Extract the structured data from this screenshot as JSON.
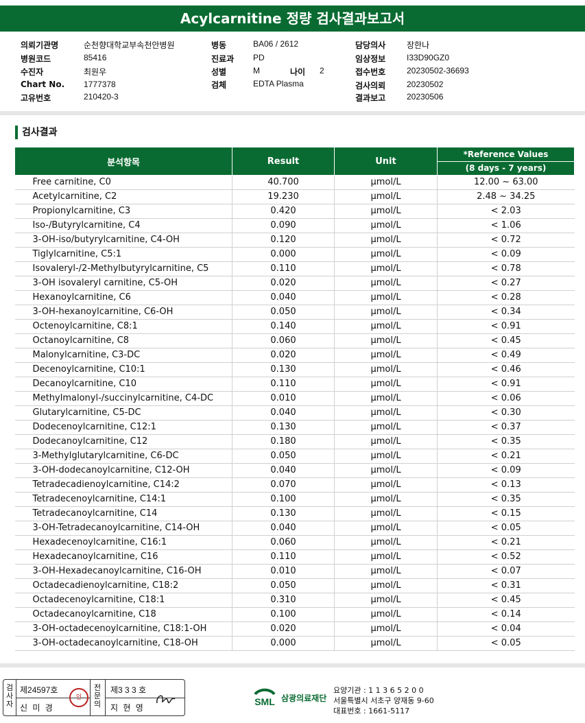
{
  "title": "Acylcarnitine 정량 검사결과보고서",
  "info": {
    "col1": [
      {
        "label": "의뢰기관명",
        "value": "순천향대학교부속천안병원"
      },
      {
        "label": "병원코드",
        "value": "85416"
      },
      {
        "label": "수진자",
        "value": "최원우"
      },
      {
        "label": "Chart No.",
        "value": "1777378"
      },
      {
        "label": "고유번호",
        "value": "210420-3"
      }
    ],
    "col2": [
      {
        "label": "병동",
        "value": "BA06 / 2612"
      },
      {
        "label": "진료과",
        "value": "PD"
      },
      {
        "label": "성별",
        "value": "M"
      },
      {
        "label": "검체",
        "value": "EDTA Plasma"
      }
    ],
    "age": {
      "label": "나이",
      "value": "2"
    },
    "col3": [
      {
        "label": "담당의사",
        "value": "장한나"
      },
      {
        "label": "임상정보",
        "value": "I33D90GZ0"
      },
      {
        "label": "접수번호",
        "value": "20230502-36693"
      },
      {
        "label": "검사의뢰",
        "value": "20230502"
      },
      {
        "label": "결과보고",
        "value": "20230506"
      }
    ]
  },
  "section_title": "검사결과",
  "table": {
    "headers": {
      "item": "분석항목",
      "result": "Result",
      "unit": "Unit",
      "ref": "*Reference Values",
      "ref_sub": "(8 days - 7 years)"
    },
    "rows": [
      [
        "Free carnitine, C0",
        "40.700",
        "μmol/L",
        "12.00 ~ 63.00"
      ],
      [
        "Acetylcarnitine, C2",
        "19.230",
        "μmol/L",
        "2.48 ~ 34.25"
      ],
      [
        "Propionylcarnitine, C3",
        "0.420",
        "μmol/L",
        "< 2.03"
      ],
      [
        "Iso-/Butyrylcarnitine, C4",
        "0.090",
        "μmol/L",
        "< 1.06"
      ],
      [
        "3-OH-iso/butyrylcarnitine, C4-OH",
        "0.120",
        "μmol/L",
        "< 0.72"
      ],
      [
        "Tiglylcarnitine, C5:1",
        "0.000",
        "μmol/L",
        "< 0.09"
      ],
      [
        "Isovaleryl-/2-Methylbutyrylcarnitine, C5",
        "0.110",
        "μmol/L",
        "< 0.78"
      ],
      [
        "3-OH isovaleryl carnitine, C5-OH",
        "0.020",
        "μmol/L",
        "< 0.27"
      ],
      [
        "Hexanoylcarnitine, C6",
        "0.040",
        "μmol/L",
        "< 0.28"
      ],
      [
        "3-OH-hexanoylcarnitine, C6-OH",
        "0.050",
        "μmol/L",
        "< 0.34"
      ],
      [
        "Octenoylcarnitine, C8:1",
        "0.140",
        "μmol/L",
        "< 0.91"
      ],
      [
        "Octanoylcarnitine, C8",
        "0.060",
        "μmol/L",
        "< 0.45"
      ],
      [
        "Malonylcarnitine, C3-DC",
        "0.020",
        "μmol/L",
        "< 0.49"
      ],
      [
        "Decenoylcarnitine, C10:1",
        "0.130",
        "μmol/L",
        "< 0.46"
      ],
      [
        "Decanoylcarnitine, C10",
        "0.110",
        "μmol/L",
        "< 0.91"
      ],
      [
        "Methylmalonyl-/succinylcarnitine, C4-DC",
        "0.010",
        "μmol/L",
        "< 0.06"
      ],
      [
        "Glutarylcarnitine, C5-DC",
        "0.040",
        "μmol/L",
        "< 0.30"
      ],
      [
        "Dodecenoylcarnitine, C12:1",
        "0.130",
        "μmol/L",
        "< 0.37"
      ],
      [
        "Dodecanoylcarnitine, C12",
        "0.180",
        "μmol/L",
        "< 0.35"
      ],
      [
        "3-Methylglutarylcarnitine, C6-DC",
        "0.050",
        "μmol/L",
        "< 0.21"
      ],
      [
        "3-OH-dodecanoylcarnitine, C12-OH",
        "0.040",
        "μmol/L",
        "< 0.09"
      ],
      [
        "Tetradecadienoylcarnitine, C14:2",
        "0.070",
        "μmol/L",
        "< 0.13"
      ],
      [
        "Tetradecenoylcarnitine, C14:1",
        "0.100",
        "μmol/L",
        "< 0.35"
      ],
      [
        "Tetradecanoylcarnitine, C14",
        "0.130",
        "μmol/L",
        "< 0.15"
      ],
      [
        "3-OH-Tetradecanoylcarnitine, C14-OH",
        "0.040",
        "μmol/L",
        "< 0.05"
      ],
      [
        "Hexadecenoylcarnitine, C16:1",
        "0.060",
        "μmol/L",
        "< 0.21"
      ],
      [
        "Hexadecanoylcarnitine, C16",
        "0.110",
        "μmol/L",
        "< 0.52"
      ],
      [
        "3-OH-Hexadecanoylcarnitine, C16-OH",
        "0.010",
        "μmol/L",
        "< 0.07"
      ],
      [
        "Octadecadienoylcarnitine, C18:2",
        "0.050",
        "μmol/L",
        "< 0.31"
      ],
      [
        "Octadecenoylcarnitine, C18:1",
        "0.310",
        "μmol/L",
        "< 0.45"
      ],
      [
        "Octadecanoylcarnitine, C18",
        "0.100",
        "μmol/L",
        "< 0.14"
      ],
      [
        "3-OH-octadecenoylcarnitine, C18:1-OH",
        "0.020",
        "μmol/L",
        "< 0.04"
      ],
      [
        "3-OH-octadecanoylcarnitine, C18-OH",
        "0.000",
        "μmol/L",
        "< 0.05"
      ]
    ]
  },
  "footer": {
    "tester_label": "검사자",
    "tester_license": "제24597호",
    "tester_name": "신 미 경",
    "tester_stamp": "인",
    "specialist_label": "전문의",
    "specialist_license": "제3 3 3 호",
    "specialist_name": "지 현 영",
    "logo_text": "SML",
    "org_name": "삼광의료재단",
    "agency_no": "요양기관 : 1 1 3 6 5 2 0 0",
    "address": "서울특별시 서초구 양재동 9-60",
    "phone": "대표번호 : 1661-5117"
  },
  "colors": {
    "brand_green": "#0a6b32",
    "stamp_red": "#b22222"
  }
}
